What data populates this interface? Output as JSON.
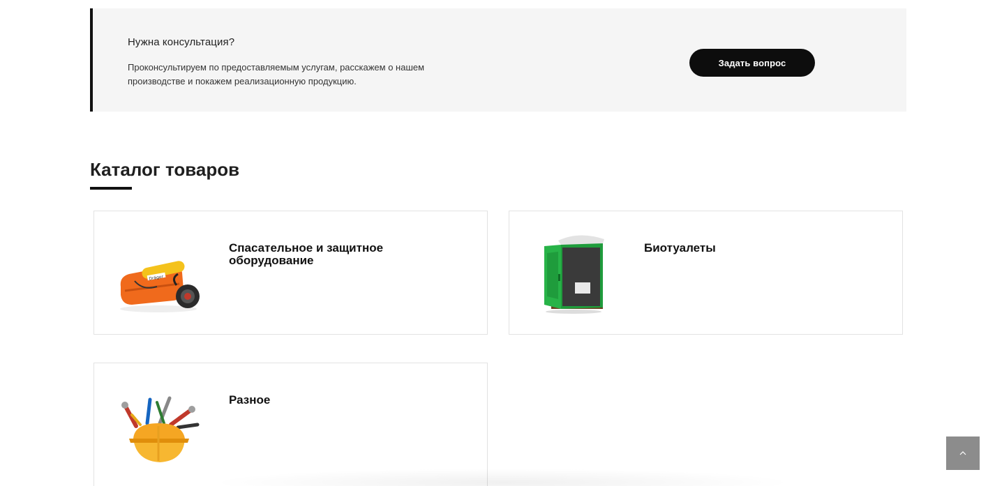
{
  "consultation": {
    "title": "Нужна консультация?",
    "text": "Проконсультируем по предоставляемым услугам, расскажем о нашем производстве и покажем реализационную продукцию.",
    "button_label": "Задать вопрос"
  },
  "catalog": {
    "heading": "Каталог товаров",
    "items": [
      {
        "title": "Спасательное и защитное оборудование",
        "icon": "rescue-equipment-image"
      },
      {
        "title": "Биотуалеты",
        "icon": "portable-toilet-image"
      },
      {
        "title": "Разное",
        "icon": "tools-helmet-image"
      }
    ]
  },
  "scroll_top": {
    "icon": "chevron-up-icon"
  },
  "colors": {
    "banner_bg": "#f5f5f5",
    "accent": "#111111",
    "button_bg": "#0d0d0d",
    "scroll_btn": "#8c8c8c"
  }
}
